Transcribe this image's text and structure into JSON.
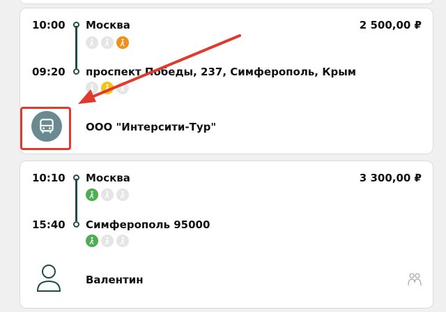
{
  "trips": [
    {
      "depart_time": "10:00",
      "from": "Москва",
      "arrive_time": "09:20",
      "to": "проспект Победы, 237, Симферополь, Крым",
      "price": "2 500,00 ₽",
      "carrier": "ООО \"Интерсити-Тур\"",
      "from_icons": [
        "walker-gray-icon",
        "walker-gray-icon",
        "walker-orange-icon"
      ],
      "to_icons": [
        "walker-gray-icon",
        "walker-yellow-icon",
        "walker-gray-icon"
      ]
    },
    {
      "depart_time": "10:10",
      "from": "Москва",
      "arrive_time": "15:40",
      "to": "Симферополь 95000",
      "price": "3 300,00 ₽",
      "carrier": "Валентин",
      "from_icons": [
        "walker-green-icon",
        "walker-gray-icon",
        "walker-gray-icon"
      ],
      "to_icons": [
        "walker-green-icon",
        "walker-gray-icon",
        "walker-gray-icon"
      ]
    }
  ],
  "colors": {
    "rail": "#1f4d47",
    "highlight": "#e03a2e",
    "bus_badge": "#6b8a90",
    "orange": "#ef8f1c",
    "yellow": "#f3c316",
    "green": "#4caf50"
  }
}
